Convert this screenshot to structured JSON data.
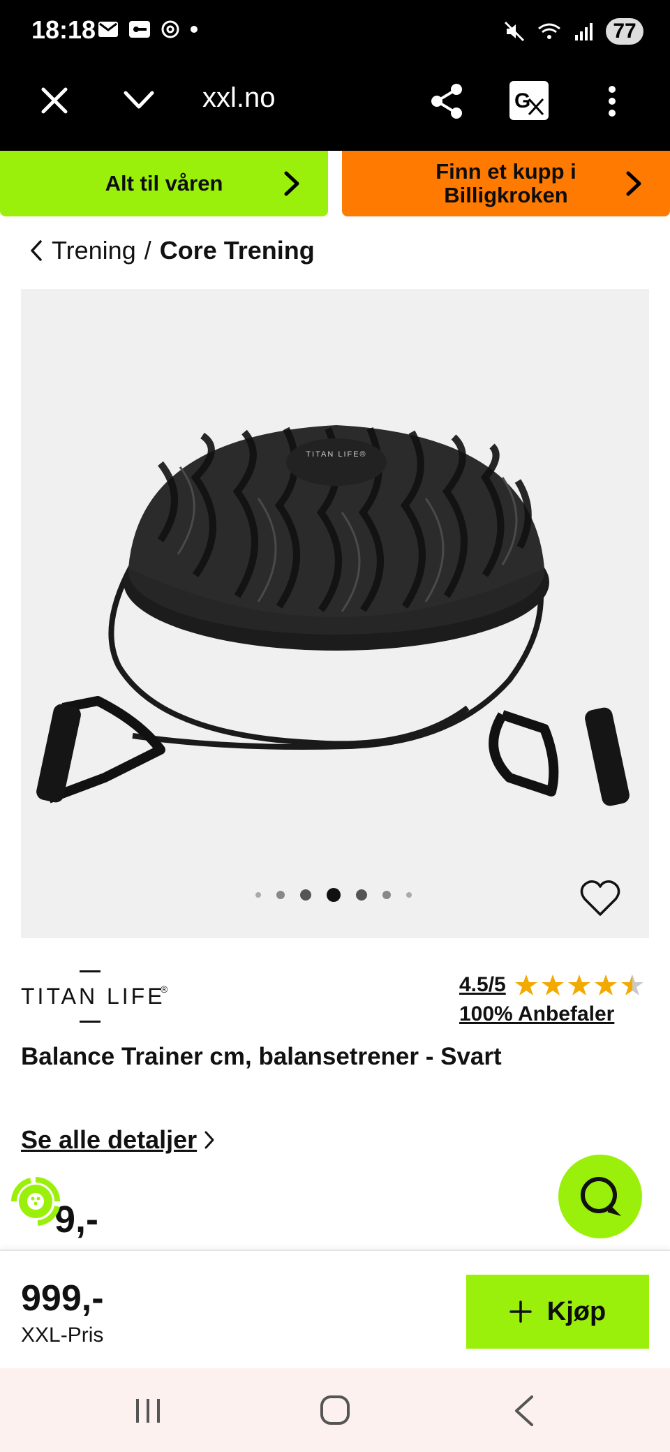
{
  "status_bar": {
    "time": "18:18",
    "battery": "77"
  },
  "browser": {
    "url": "xxl.no"
  },
  "banners": [
    {
      "label": "Alt til våren",
      "color": "#9bf00b"
    },
    {
      "label": "Finn et kupp i Billigkroken",
      "color": "#ff7a00"
    }
  ],
  "breadcrumb": {
    "parent": "Trening",
    "separator": "/",
    "current": "Core Trening"
  },
  "product_image": {
    "logo_text": "TITAN LIFE®",
    "active_dot": 4,
    "dot_count": 7
  },
  "brand": {
    "name": "TITAN LIFE",
    "registered": "®"
  },
  "rating": {
    "value": "4.5/5",
    "stars": 4.5,
    "recommend": "100% Anbefaler"
  },
  "product": {
    "title": "Balance Trainer cm, balansetrener - Svart"
  },
  "details_link": "Se alle detaljer",
  "partial_price": "9,-",
  "buy_bar": {
    "price": "999,-",
    "price_label": "XXL-Pris",
    "buy_label": "Kjøp"
  },
  "colors": {
    "accent_green": "#9bf00b",
    "accent_orange": "#ff7a00"
  }
}
